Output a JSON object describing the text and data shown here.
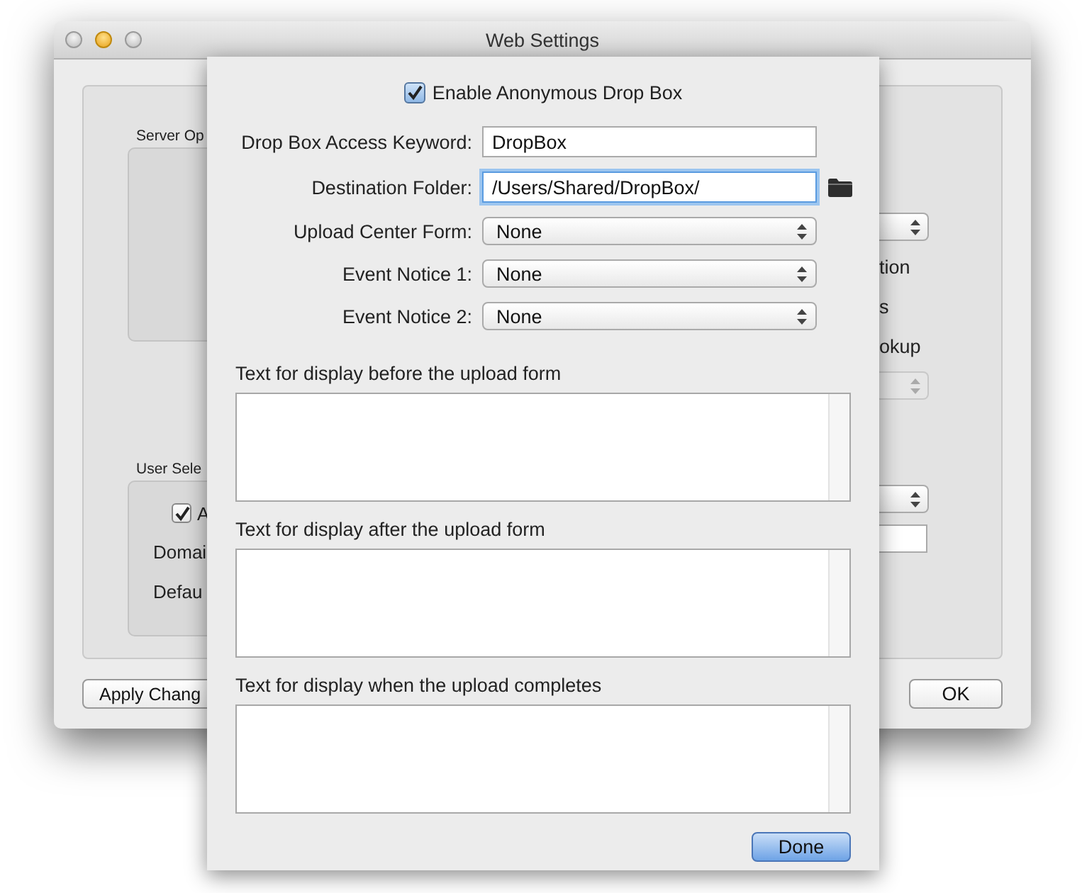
{
  "window": {
    "title": "Web Settings"
  },
  "background": {
    "server_group_label": "Server Op",
    "user_group_label": "User Sele",
    "user_checkbox": {
      "label": "A",
      "checked": true
    },
    "user_labels": [
      "Domai",
      "Defau"
    ],
    "right_server_items": [
      {
        "kind": "select",
        "disabled": false
      },
      {
        "kind": "text",
        "text": "tion"
      },
      {
        "kind": "text",
        "text": "s"
      },
      {
        "kind": "text",
        "text": "okup"
      },
      {
        "kind": "select",
        "disabled": true
      }
    ],
    "right_user_items": [
      {
        "kind": "select",
        "disabled": false
      },
      {
        "kind": "field"
      }
    ],
    "apply_button": "Apply Chang",
    "ok_button": "OK"
  },
  "sheet": {
    "enable_checkbox": {
      "label": "Enable Anonymous Drop Box",
      "checked": true
    },
    "fields": [
      {
        "kind": "text",
        "label": "Drop Box Access Keyword:",
        "value": "DropBox",
        "focused": false
      },
      {
        "kind": "folder",
        "label": "Destination Folder:",
        "value": "/Users/Shared/DropBox/",
        "focused": true
      },
      {
        "kind": "select",
        "label": "Upload Center Form:",
        "value": "None"
      },
      {
        "kind": "select",
        "label": "Event Notice 1:",
        "value": "None"
      },
      {
        "kind": "select",
        "label": "Event Notice 2:",
        "value": "None"
      }
    ],
    "text_areas": [
      {
        "label": "Text for display before the upload form"
      },
      {
        "label": "Text for display after the upload form"
      },
      {
        "label": "Text for display when the upload completes"
      }
    ],
    "done_button": "Done"
  }
}
